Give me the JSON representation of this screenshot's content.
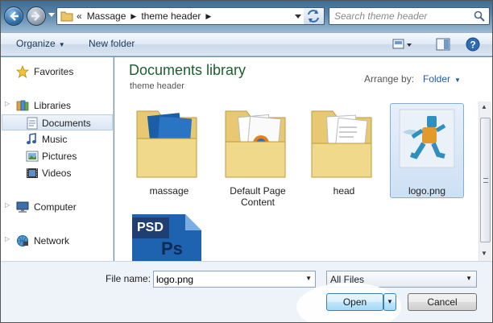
{
  "address_bar": {
    "overflow_chevron": "«",
    "crumbs": [
      "Massage",
      "theme header"
    ],
    "search_placeholder": "Search theme header"
  },
  "toolbar": {
    "organize_label": "Organize",
    "new_folder_label": "New folder"
  },
  "sidebar": {
    "items": [
      {
        "label": "Favorites",
        "icon": "star-icon"
      },
      {
        "label": "Libraries",
        "icon": "libraries-icon"
      },
      {
        "label": "Documents",
        "icon": "documents-icon",
        "selected": true
      },
      {
        "label": "Music",
        "icon": "music-icon"
      },
      {
        "label": "Pictures",
        "icon": "pictures-icon"
      },
      {
        "label": "Videos",
        "icon": "videos-icon"
      },
      {
        "label": "Computer",
        "icon": "computer-icon"
      },
      {
        "label": "Network",
        "icon": "network-icon"
      }
    ]
  },
  "main": {
    "library_title": "Documents library",
    "library_subtitle": "theme header",
    "arrange_label": "Arrange by:",
    "arrange_value": "Folder",
    "files": [
      {
        "name": "massage",
        "type": "folder"
      },
      {
        "name": "Default Page Content",
        "type": "folder"
      },
      {
        "name": "head",
        "type": "folder"
      },
      {
        "name": "logo.png",
        "type": "image",
        "selected": true
      },
      {
        "name": "",
        "type": "psd",
        "badge": "PSD"
      }
    ]
  },
  "bottom": {
    "file_name_label": "File name:",
    "file_name_value": "logo.png",
    "file_type_value": "All Files",
    "open_label": "Open",
    "cancel_label": "Cancel"
  },
  "colors": {
    "title_green": "#1c5f2f",
    "link_blue": "#1e5bb0",
    "selection_blue": "#cde0f4"
  }
}
